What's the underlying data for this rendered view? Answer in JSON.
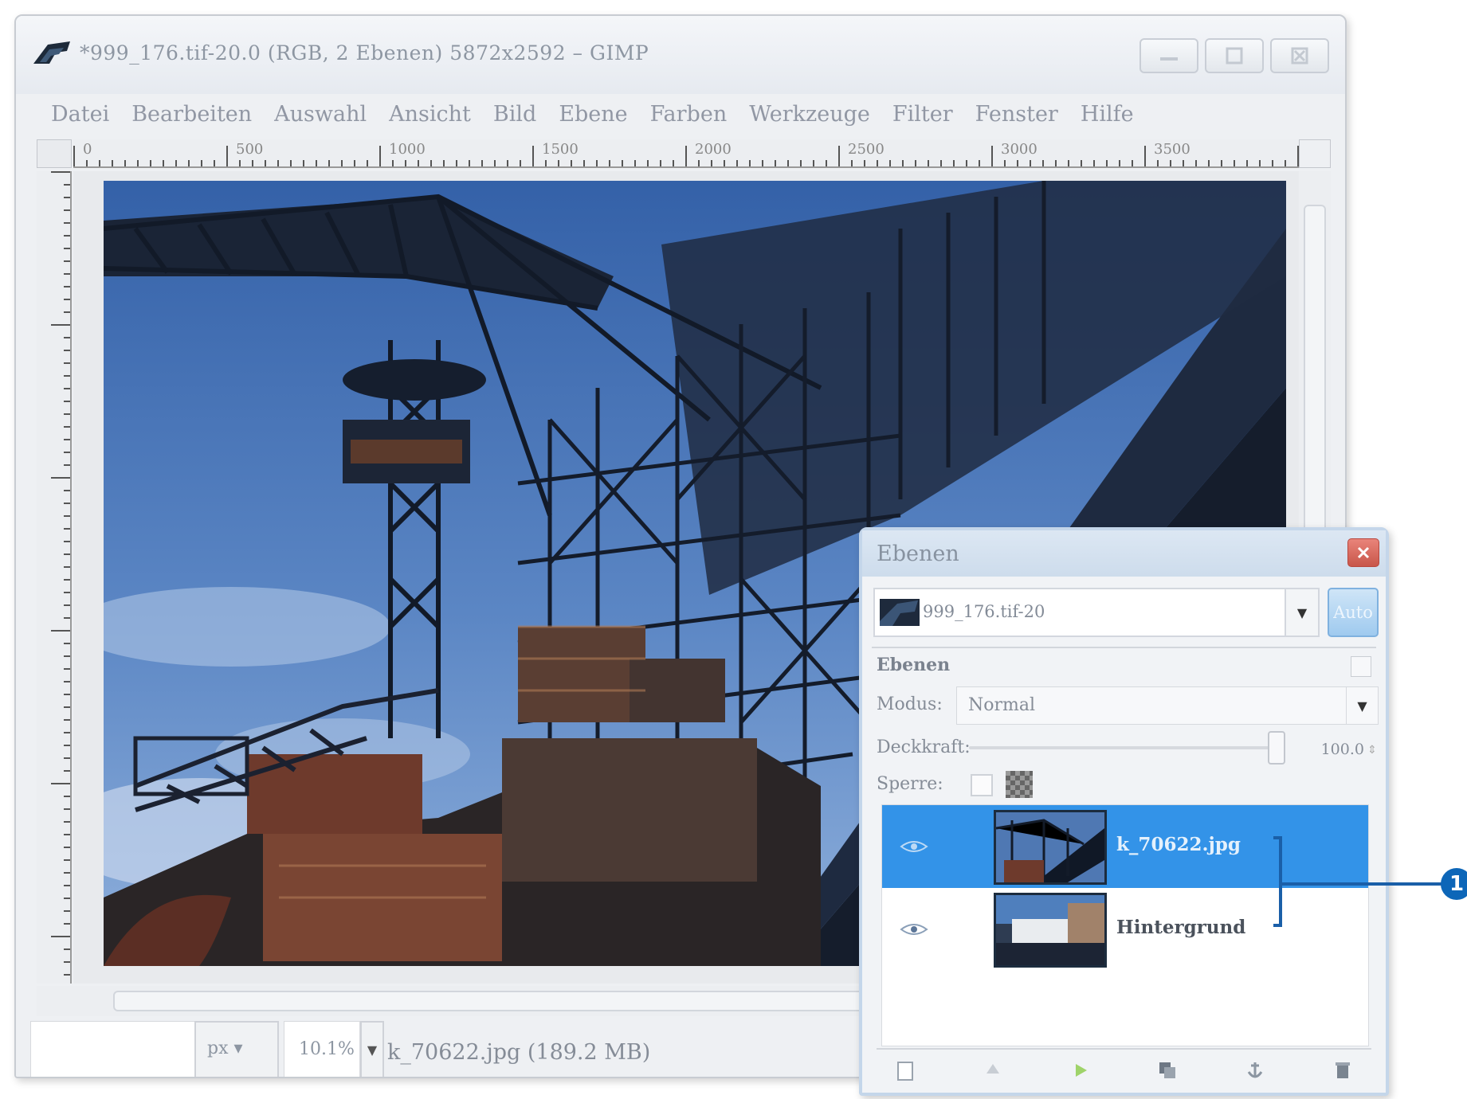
{
  "window": {
    "title": "*999_176.tif-20.0 (RGB, 2 Ebenen) 5872x2592 – GIMP"
  },
  "menu": [
    "Datei",
    "Bearbeiten",
    "Auswahl",
    "Ansicht",
    "Bild",
    "Ebene",
    "Farben",
    "Werkzeuge",
    "Filter",
    "Fenster",
    "Hilfe"
  ],
  "ruler": {
    "labels": [
      "0",
      "500",
      "1000",
      "1500",
      "2000",
      "2500",
      "3000",
      "3500"
    ]
  },
  "statusbar": {
    "unit": "px",
    "zoom": "10.1%",
    "info": "k_70622.jpg (189.2 MB)"
  },
  "layers_dialog": {
    "title": "Ebenen",
    "image_name": "999_176.tif-20",
    "auto_label": "Auto",
    "tab_heading": "Ebenen",
    "mode_label": "Modus:",
    "mode_value": "Normal",
    "opacity_label": "Deckkraft:",
    "opacity_value": "100.0",
    "opacity_level": 1.0,
    "lock_label": "Sperre:",
    "layers": [
      {
        "name": "k_70622.jpg",
        "selected": true,
        "visible": true
      },
      {
        "name": "Hintergrund",
        "selected": false,
        "visible": true
      }
    ],
    "footer_icons": [
      "new-layer-icon",
      "raise-layer-icon",
      "lower-layer-icon",
      "duplicate-layer-icon",
      "anchor-layer-icon",
      "delete-layer-icon"
    ]
  },
  "callout": {
    "number": "1"
  },
  "colors": {
    "selection": "#3393e8",
    "callout": "#0d66b8"
  }
}
